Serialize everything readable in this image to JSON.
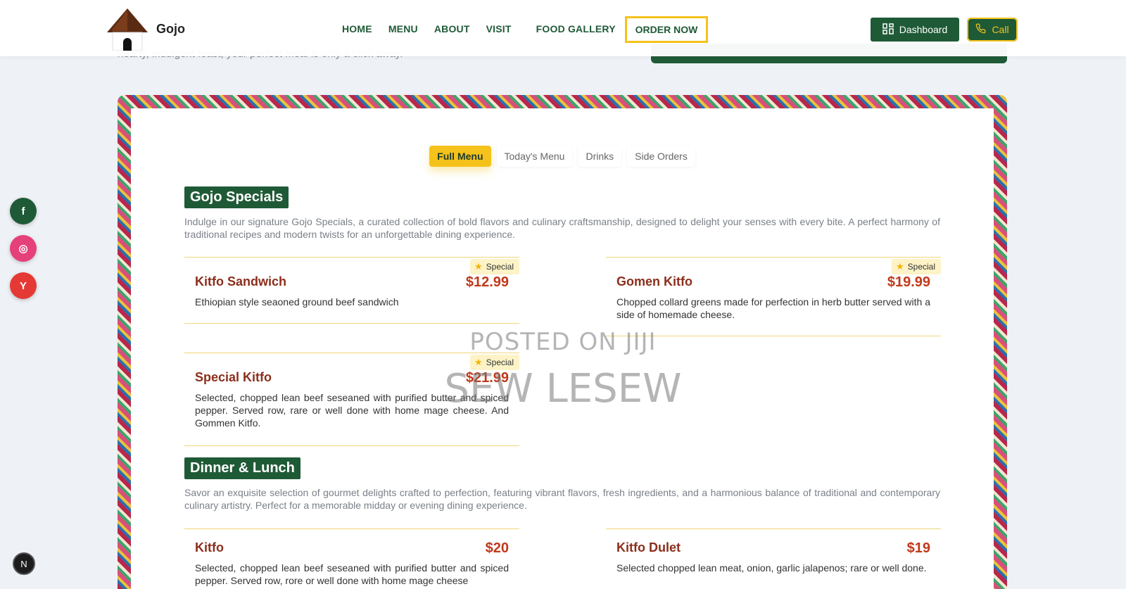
{
  "hero": {
    "faded_text": "hearty, indulgent feast, your perfect meal is only a click away."
  },
  "header": {
    "brand": "Gojo",
    "nav": [
      "HOME",
      "MENU",
      "ABOUT",
      "VISIT",
      "FOOD GALLERY"
    ],
    "order_now": "ORDER NOW",
    "dashboard": "Dashboard",
    "call": "Call"
  },
  "social": {
    "facebook": "f",
    "instagram": "◎",
    "youtube": "Y"
  },
  "badge": "N",
  "tabs": [
    "Full Menu",
    "Today's Menu",
    "Drinks",
    "Side Orders"
  ],
  "sections": [
    {
      "title": "Gojo Specials",
      "description": "Indulge in our signature Gojo Specials, a curated collection of bold flavors and culinary craftsmanship, designed to delight your senses with every bite. A perfect harmony of traditional recipes and modern twists for an unforgettable dining experience.",
      "items": [
        {
          "name": "Kitfo Sandwich",
          "price": "$12.99",
          "desc": "Ethiopian style seaoned ground beef sandwich",
          "badge": "Special"
        },
        {
          "name": "Gomen Kitfo",
          "price": "$19.99",
          "desc": "Chopped collard greens made for perfection in herb butter served with a side of homemade cheese.",
          "badge": "Special"
        },
        {
          "name": "Special Kitfo",
          "price": "$21.99",
          "desc": "Selected, chopped lean beef seseaned with purified butter and spiced pepper. Served row, rare or well done with home mage cheese. And Gommen Kitfo.",
          "badge": "Special"
        }
      ]
    },
    {
      "title": "Dinner & Lunch",
      "description": "Savor an exquisite selection of gourmet delights crafted to perfection, featuring vibrant flavors, fresh ingredients, and a harmonious balance of traditional and contemporary culinary artistry. Perfect for a memorable midday or evening dining experience.",
      "items": [
        {
          "name": "Kitfo",
          "price": "$20",
          "desc": "Selected, chopped lean beef seseaned with purified butter and spiced pepper. Served row, rore or well done with home mage cheese"
        },
        {
          "name": "Kitfo Dulet",
          "price": "$19",
          "desc": "Selected chopped lean meat, onion, garlic jalapenos; rare or well done."
        }
      ]
    }
  ],
  "watermark": {
    "line1": "POSTED ON JIJI",
    "line2": "SEW LESEW"
  },
  "colors": {
    "brand_green": "#1f5a36",
    "accent_yellow": "#f4c21b",
    "price_red": "#c0391b"
  }
}
